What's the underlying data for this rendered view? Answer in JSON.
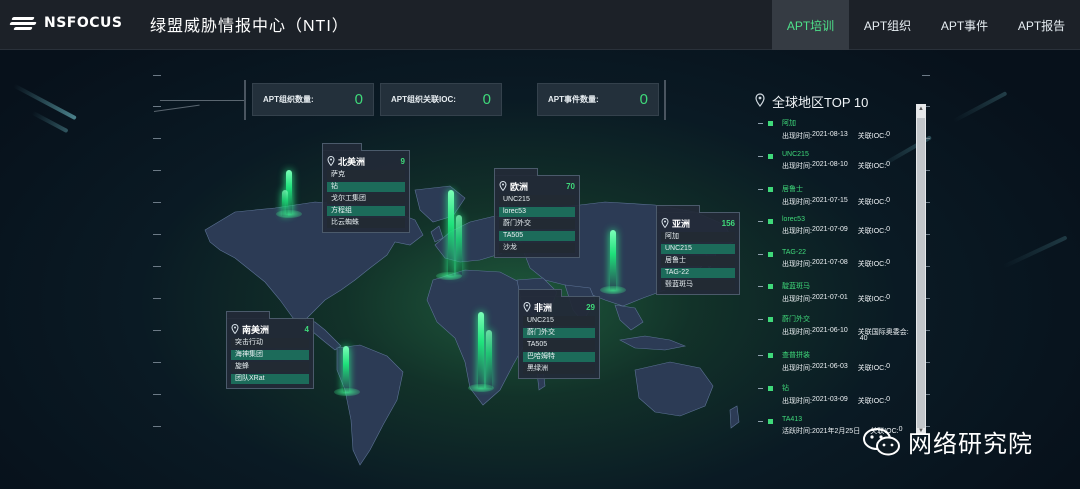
{
  "header": {
    "logo_text": "NSFOCUS",
    "title": "绿盟威胁情报中心（NTI）",
    "nav": [
      {
        "label": "APT培训",
        "active": true
      },
      {
        "label": "APT组织",
        "active": false
      },
      {
        "label": "APT事件",
        "active": false
      },
      {
        "label": "APT报告",
        "active": false
      }
    ]
  },
  "stats": [
    {
      "label": "APT组织数量:",
      "value": "0"
    },
    {
      "label": "APT组织关联IOC:",
      "value": "0"
    },
    {
      "label": "APT事件数量:",
      "value": "0"
    }
  ],
  "continents": {
    "north_america": {
      "name": "北美洲",
      "count": "9",
      "items": [
        "萨克",
        "钻",
        "戈尔工集团",
        "方程组",
        "比云蜘蛛"
      ]
    },
    "europe": {
      "name": "欧洲",
      "count": "70",
      "items": [
        "UNC215",
        "lorec53",
        "蔚门外交",
        "TA505",
        "沙龙"
      ]
    },
    "asia": {
      "name": "亚洲",
      "count": "156",
      "items": [
        "阿加",
        "UNC215",
        "居鲁士",
        "TAG-22",
        "毂蓝斑马"
      ]
    },
    "africa": {
      "name": "非洲",
      "count": "29",
      "items": [
        "UNC215",
        "蔚门外交",
        "TA505",
        "巴哈姆特",
        "黑绿洲"
      ]
    },
    "south_america": {
      "name": "南美洲",
      "count": "4",
      "items": [
        "突击行动",
        "海神集团",
        "旋蜂",
        "团队XRat"
      ]
    }
  },
  "top10": {
    "title": "全球地区TOP 10",
    "items": [
      {
        "name": "阿加",
        "time_label": "出现时间:",
        "time": "2021-08-13",
        "ioc_label": "关联IOC:",
        "ioc": "0"
      },
      {
        "name": "UNC215",
        "time_label": "出现时间:",
        "time": "2021-08-10",
        "ioc_label": "关联IOC:",
        "ioc": "0"
      },
      {
        "name": "居鲁士",
        "time_label": "出现时间:",
        "time": "2021-07-15",
        "ioc_label": "关联IOC:",
        "ioc": "0"
      },
      {
        "name": "lorec53",
        "time_label": "出现时间:",
        "time": "2021-07-09",
        "ioc_label": "关联IOC:",
        "ioc": "0"
      },
      {
        "name": "TAG-22",
        "time_label": "出现时间:",
        "time": "2021-07-08",
        "ioc_label": "关联IOC:",
        "ioc": "0"
      },
      {
        "name": "靛蓝斑马",
        "time_label": "出现时间:",
        "time": "2021-07-01",
        "ioc_label": "关联IOC:",
        "ioc": "0"
      },
      {
        "name": "蔚门外交",
        "time_label": "出现时间:",
        "time": "2021-06-10",
        "ioc_label": "关联国际奥委会:",
        "ioc": "40"
      },
      {
        "name": "查普拼装",
        "time_label": "出现时间:",
        "time": "2021-06-03",
        "ioc_label": "关联IOC:",
        "ioc": "0"
      },
      {
        "name": "钻",
        "time_label": "出现时间:",
        "time": "2021-03-09",
        "ioc_label": "关联IOC:",
        "ioc": "0"
      },
      {
        "name": "TA413",
        "time_label": "活跃时间:",
        "time": "2021年2月25日",
        "ioc_label": "关联IOC:",
        "ioc": "0"
      }
    ]
  },
  "watermark": {
    "text": "网络研究院"
  },
  "colors": {
    "accent": "#3fd97a",
    "topbar": "#1c2128",
    "panel": "#222a38",
    "teal_row": "#1c6b5a"
  }
}
